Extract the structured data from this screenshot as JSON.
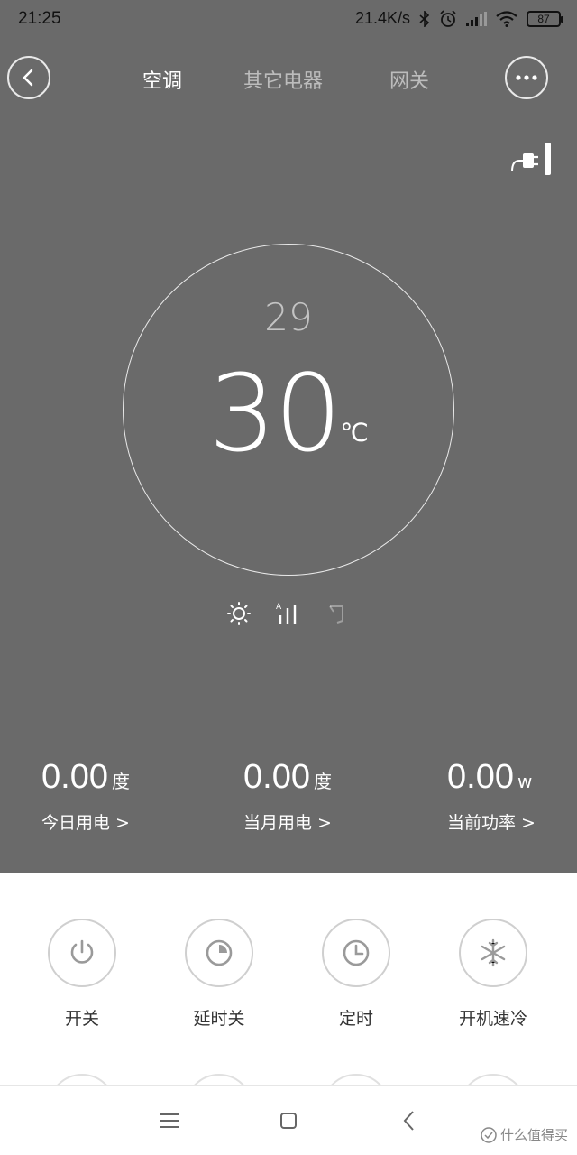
{
  "status_bar": {
    "time": "21:25",
    "net_speed": "21.4K/s",
    "battery": "87"
  },
  "nav": {
    "tabs": [
      {
        "label": "空调",
        "active": true
      },
      {
        "label": "其它电器",
        "active": false
      },
      {
        "label": "网关",
        "active": false
      }
    ]
  },
  "thermostat": {
    "target_temp": "29",
    "current_temp": "30",
    "unit": "℃"
  },
  "stats": [
    {
      "value": "0.00",
      "unit": "度",
      "label": "今日用电 >"
    },
    {
      "value": "0.00",
      "unit": "度",
      "label": "当月用电 >"
    },
    {
      "value": "0.00",
      "unit": "w",
      "label": "当前功率 >"
    }
  ],
  "controls": [
    {
      "label": "开关",
      "icon": "power-icon"
    },
    {
      "label": "延时关",
      "icon": "delay-timer-icon"
    },
    {
      "label": "定时",
      "icon": "clock-icon"
    },
    {
      "label": "开机速冷",
      "icon": "snowflake-icon"
    }
  ],
  "watermark": "什么值得买",
  "colors": {
    "background": "#6a6a6a",
    "panel": "#ffffff",
    "icon_gray": "#9a9a9a"
  }
}
